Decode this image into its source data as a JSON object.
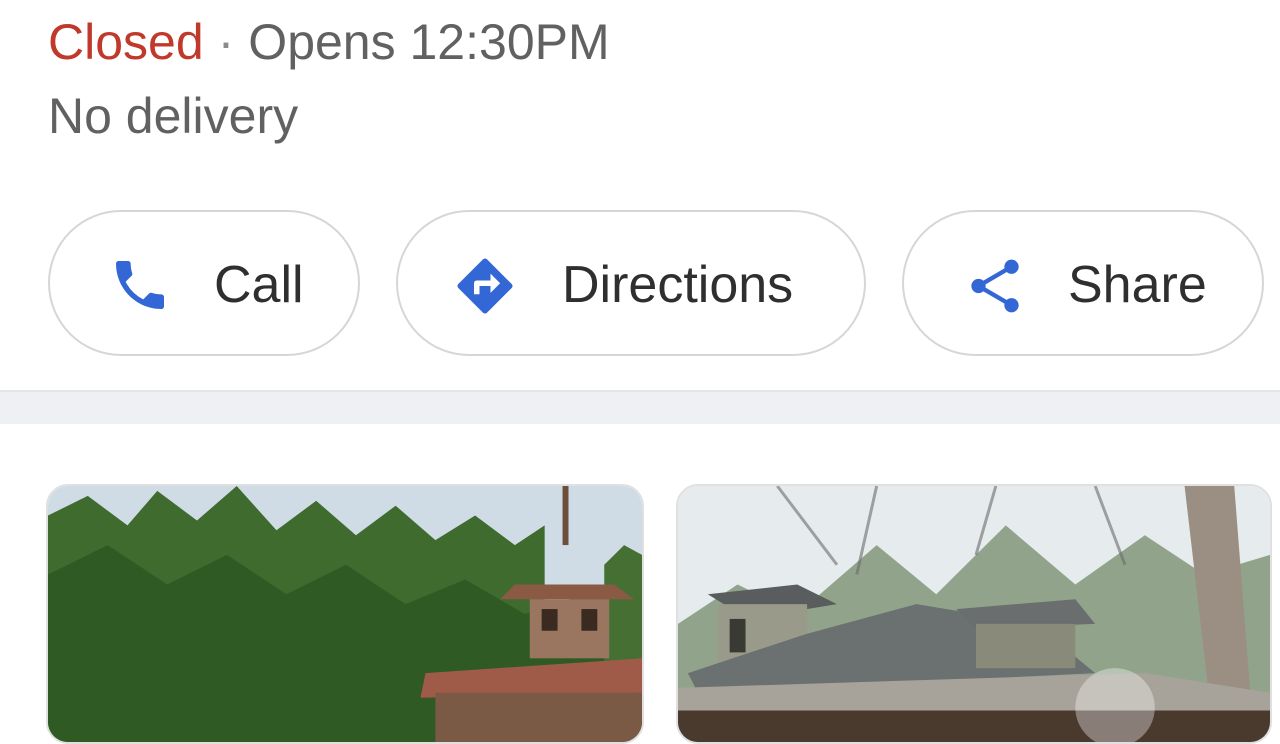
{
  "place": {
    "status": "Closed",
    "separator": "·",
    "opens": "Opens 12:30PM",
    "delivery": "No delivery"
  },
  "actions": [
    {
      "label": "Call",
      "icon": "phone-icon"
    },
    {
      "label": "Directions",
      "icon": "directions-icon"
    },
    {
      "label": "Share",
      "icon": "share-icon"
    }
  ],
  "colors": {
    "closed": "#c0392b",
    "secondary_text": "#616161",
    "icon_blue": "#3367d6",
    "chip_border": "#d6d6d6",
    "divider": "#eef0f3"
  },
  "photos": [
    {
      "description_icon": "building-photo"
    },
    {
      "description_icon": "building-photo"
    }
  ]
}
